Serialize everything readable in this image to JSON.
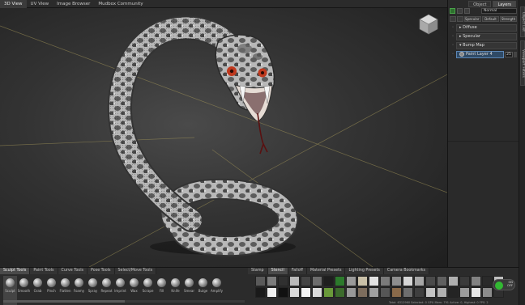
{
  "top_tabs": [
    "3D View",
    "UV View",
    "Image Browser",
    "Mudbox Community"
  ],
  "right_panel": {
    "tabs": [
      "Object",
      "Layers"
    ],
    "active_tab": "Layers",
    "mode_select": "Normal",
    "header_chips": [
      "Specular (1)",
      "Default",
      "Strength"
    ],
    "layers": [
      {
        "name": "Diffuse",
        "expander": "▸"
      },
      {
        "name": "Specular",
        "expander": "▸"
      },
      {
        "name": "Bump Map",
        "expander": "▾"
      },
      {
        "name": "Paint Layer 4",
        "value": "25",
        "selected": true
      }
    ]
  },
  "vertical_tabs": [
    "Object List",
    "Viewport Filters"
  ],
  "bottom_left_tabs": [
    "Sculpt Tools",
    "Paint Tools",
    "Curve Tools",
    "Pose Tools",
    "Select/Move Tools"
  ],
  "bottom_left_active": "Sculpt Tools",
  "sculpt_tools": [
    "Sculpt",
    "Smooth",
    "Grab",
    "Pinch",
    "Flatten",
    "Foamy",
    "Spray",
    "Repeat",
    "Imprint",
    "Wax",
    "Scrape",
    "Fill",
    "Knife",
    "Smear",
    "Bulge",
    "Amplify"
  ],
  "bottom_right_tabs": [
    "Stamp",
    "Stencil",
    "Falloff",
    "Material Presets",
    "Lighting Presets",
    "Camera Bookmarks"
  ],
  "bottom_right_active": "Stencil",
  "toggle_text": [
    "ON",
    "OFF"
  ],
  "status_text": "Total: 6312960  Selected: 0 GPU Mem: 791  Active: 0, Highest: 0  FPS: 2",
  "swatch_colors": [
    "#5a5a5a",
    "#7c7c7c",
    "#303030",
    "#b9b9b9",
    "#454545",
    "#6c6c6c",
    "#1e1e1e",
    "#2c7a2c",
    "#9a9a9a",
    "#c9c0a8",
    "#e2e2e2",
    "#7a7a7a",
    "#8e8e8e",
    "#d6d6d6",
    "#a7a7a7",
    "#4a4a4a",
    "#606060",
    "#b0b0b0",
    "#3a3a3a",
    "#828282",
    "#2a2a2a",
    "#bfbfbf",
    "#1a1a1a",
    "#f0f0f0",
    "#111111",
    "#d9d9d9",
    "#f4f4f4",
    "#dcdcdc",
    "#6a9a3a",
    "#3c6b2c",
    "#999999",
    "#7d6d5d",
    "#a0a0a0",
    "#565656",
    "#8a6a4a",
    "#6e6e6e",
    "#3f3f3f",
    "#c4c4c4",
    "#b1b1b1",
    "#242424",
    "#9c9c9c",
    "#e8e8e8",
    "#8c8c8c",
    "#2f2f2f"
  ],
  "colors": {
    "accent_blue": "#5b86b5",
    "toggle_green": "#32b832",
    "snake_eye": "#c0391e"
  }
}
